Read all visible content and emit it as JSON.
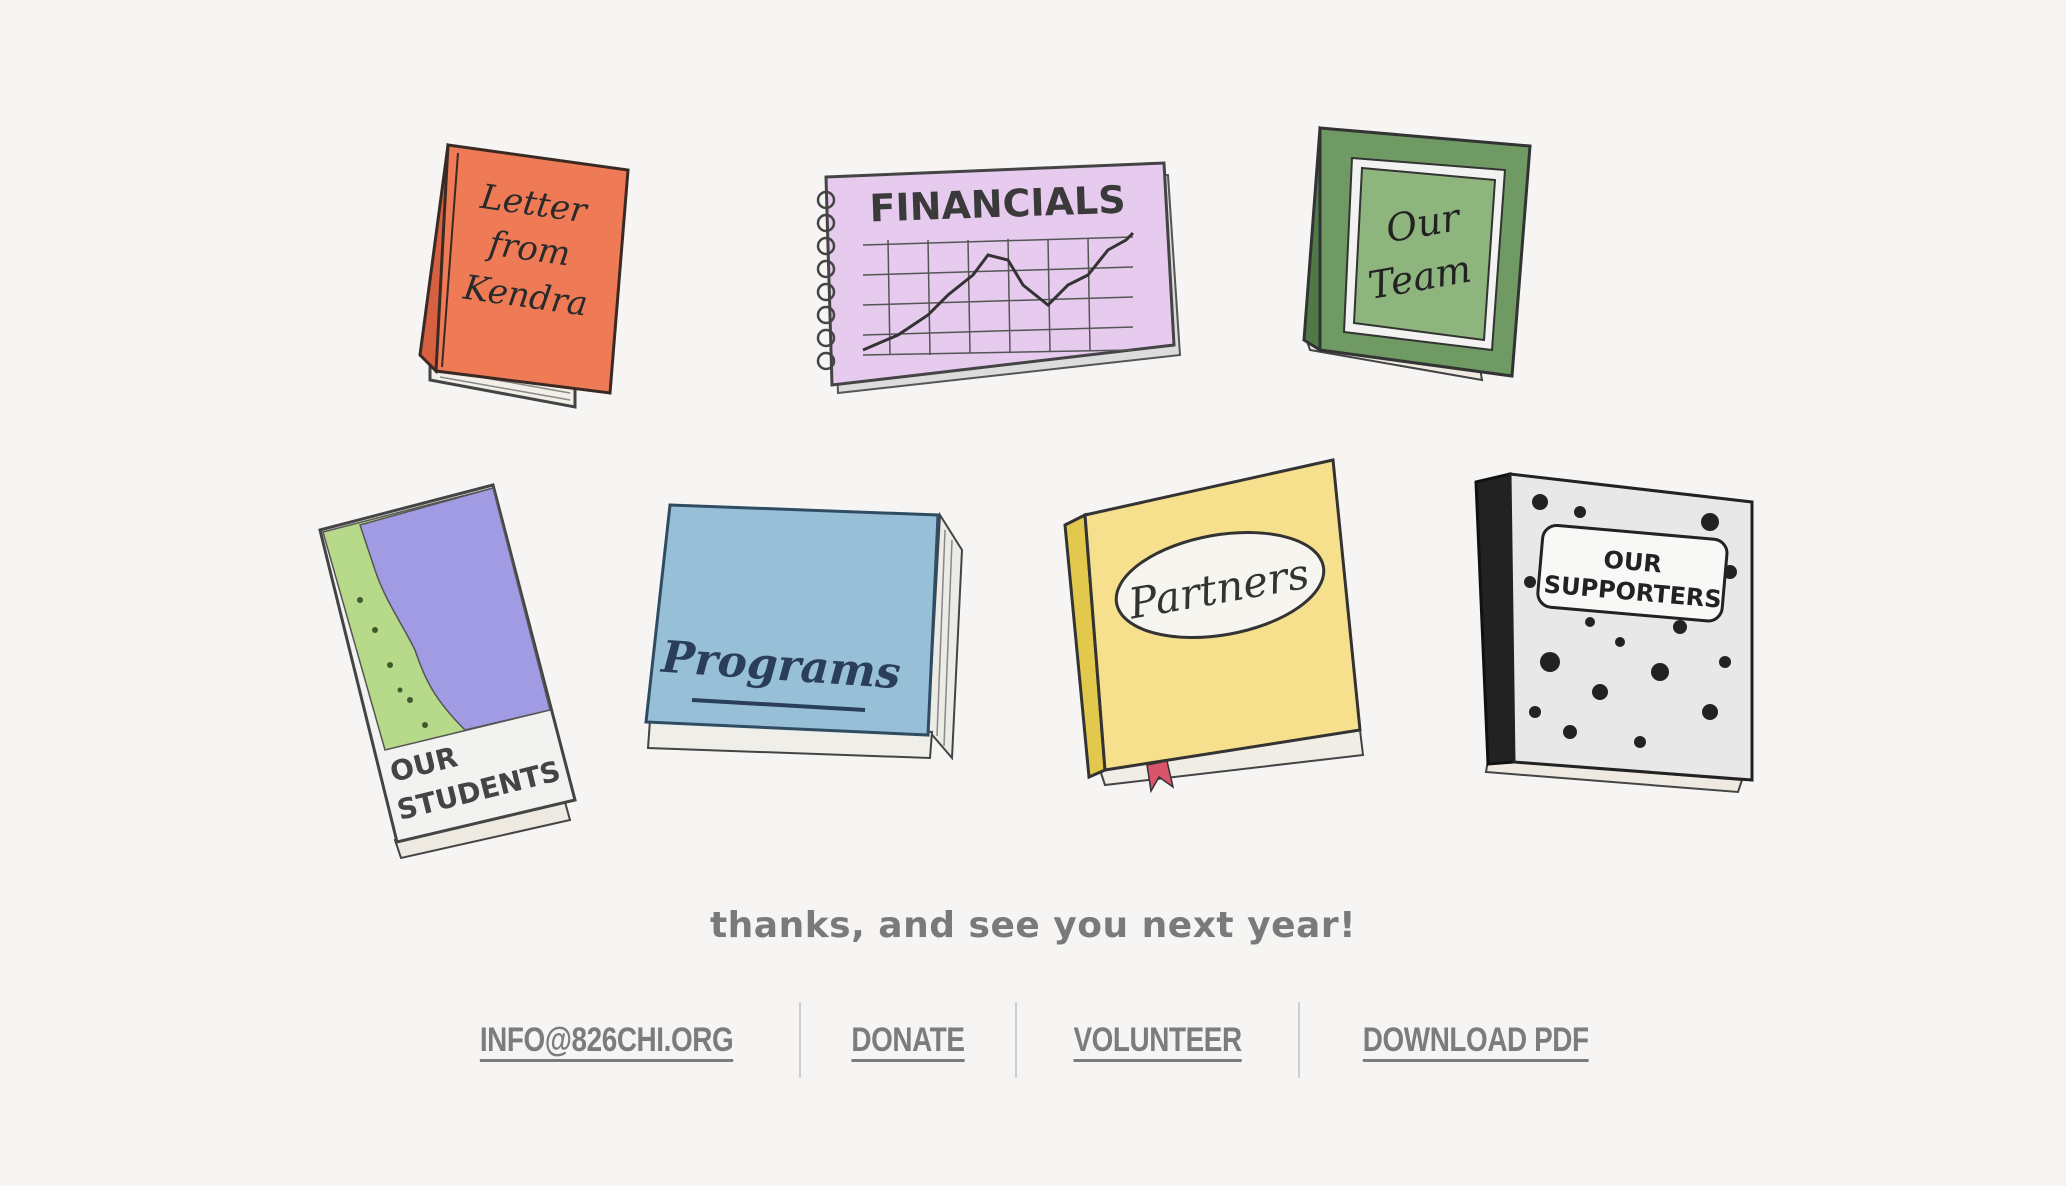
{
  "books": [
    {
      "id": "letter",
      "title_lines": [
        "Letter",
        "from",
        "Kendra"
      ],
      "cover_color": "#ef7a56",
      "spine_color": "#d66040"
    },
    {
      "id": "financials",
      "title": "FINANCIALS",
      "cover_color": "#e6cbef"
    },
    {
      "id": "team",
      "title_lines": [
        "Our",
        "Team"
      ],
      "cover_color": "#6f9a63",
      "inner_color": "#8fb57f"
    },
    {
      "id": "students",
      "title_lines": [
        "OUR",
        "STUDENTS"
      ],
      "map_land_color": "#b6d98a",
      "map_water_color": "#a09be2"
    },
    {
      "id": "programs",
      "title": "Programs",
      "cover_color": "#97c0d8"
    },
    {
      "id": "partners",
      "title": "Partners",
      "cover_color": "#f6e08e",
      "ribbon_color": "#d9546a"
    },
    {
      "id": "supporters",
      "title_lines": [
        "OUR",
        "SUPPORTERS"
      ],
      "cover_color": "#e8e8e8"
    }
  ],
  "closing_message": "thanks, and see you next year!",
  "footer": {
    "links": [
      "INFO@826CHI.ORG",
      "DONATE",
      "VOLUNTEER",
      "DOWNLOAD PDF"
    ]
  },
  "colors": {
    "background": "#f6f5f4",
    "text_gray": "#7a7a7a",
    "ink": "#2f2f2f"
  }
}
